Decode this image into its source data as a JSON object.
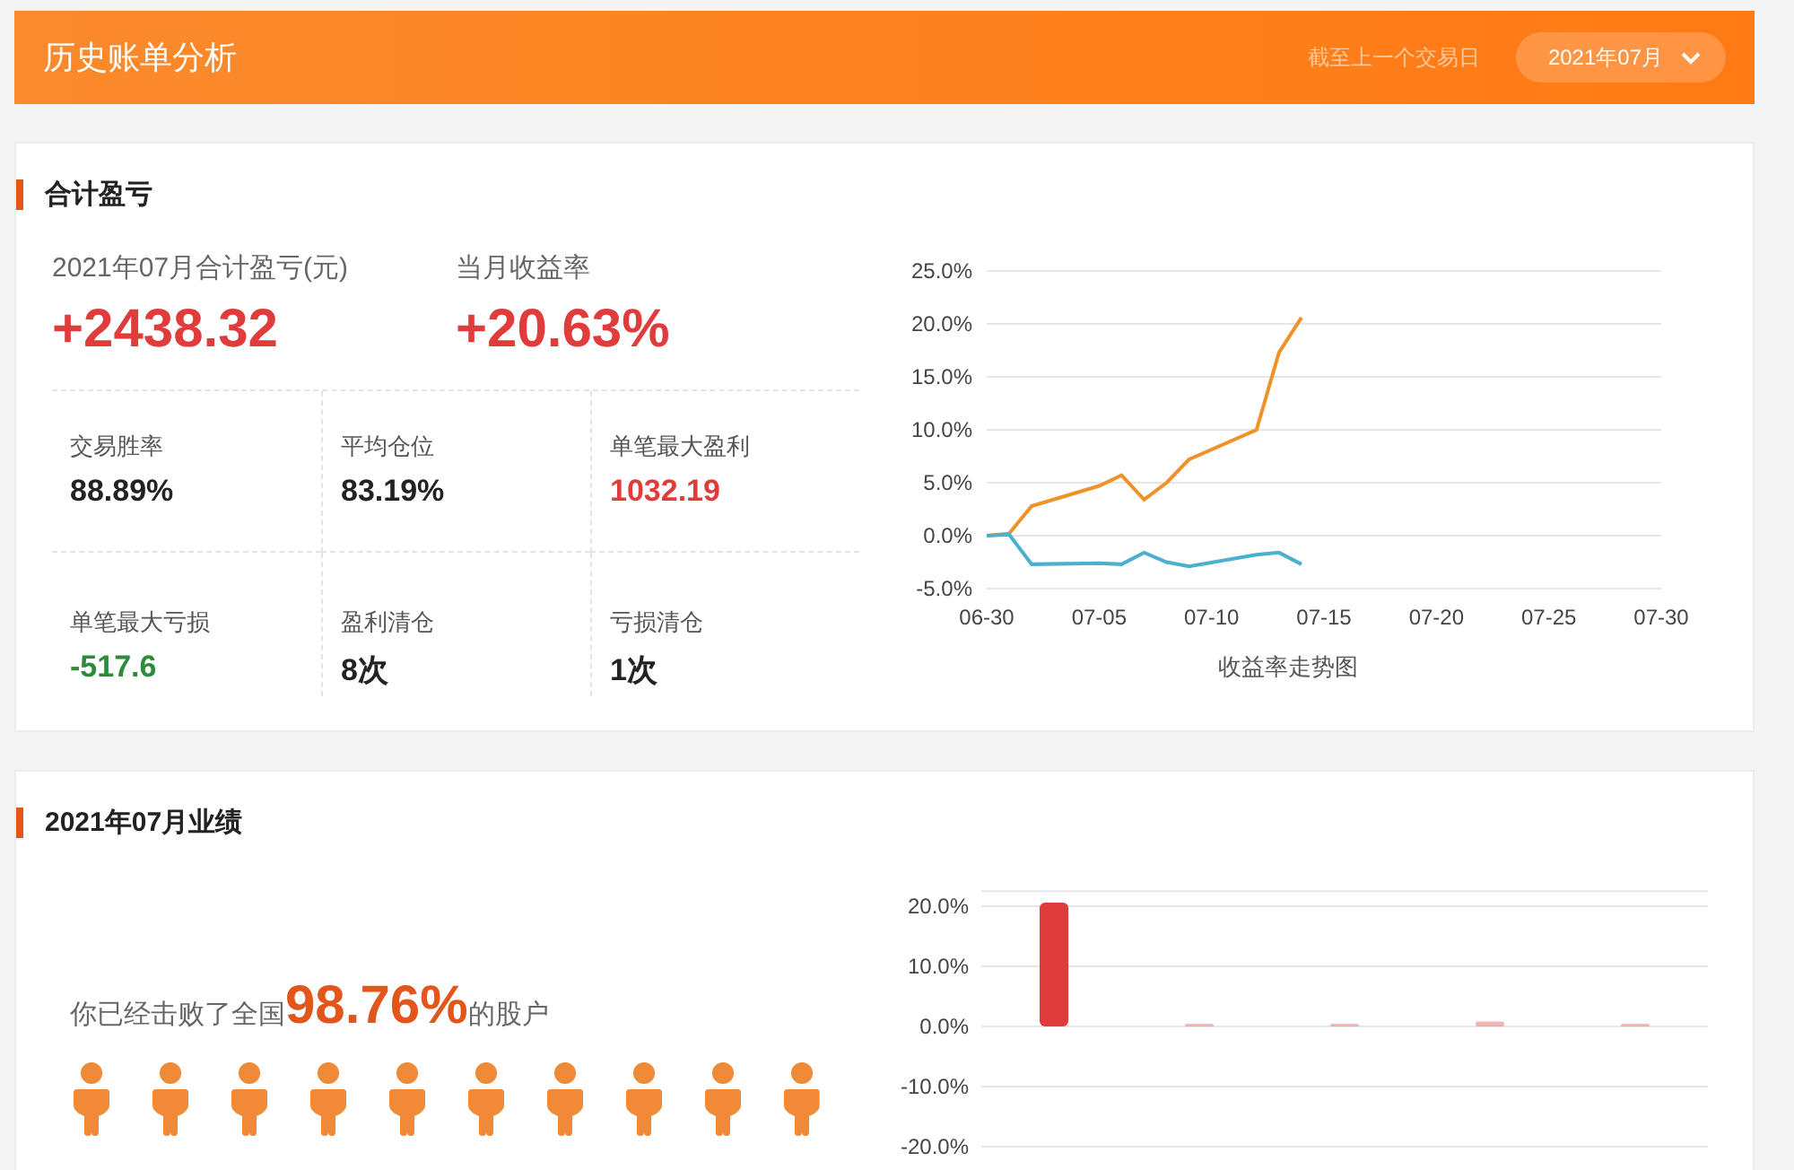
{
  "header": {
    "title": "历史账单分析",
    "note": "截至上一个交易日",
    "month_picker": {
      "value": "2021年07月"
    }
  },
  "summary": {
    "title": "合计盈亏",
    "total": {
      "label": "2021年07月合计盈亏(元)",
      "value": "+2438.32"
    },
    "rate": {
      "label": "当月收益率",
      "value": "+20.63%"
    },
    "stats": [
      {
        "label": "交易胜率",
        "value": "88.89%",
        "kind": "neutral"
      },
      {
        "label": "平均仓位",
        "value": "83.19%",
        "kind": "neutral"
      },
      {
        "label": "单笔最大盈利",
        "value": "1032.19",
        "kind": "gain"
      },
      {
        "label": "单笔最大亏损",
        "value": "-517.6",
        "kind": "loss"
      },
      {
        "label": "盈利清仓",
        "value": "8次",
        "kind": "neutral"
      },
      {
        "label": "亏损清仓",
        "value": "1次",
        "kind": "neutral"
      }
    ],
    "chart_data": {
      "type": "line",
      "title": "收益率走势图",
      "categories": [
        "06-30",
        null,
        null,
        null,
        null,
        "07-05",
        null,
        null,
        null,
        null,
        "07-10",
        null,
        null,
        null,
        null,
        "07-15",
        null,
        null,
        null,
        null,
        "07-20",
        null,
        null,
        null,
        null,
        "07-25",
        null,
        null,
        null,
        null,
        "07-30"
      ],
      "series": [
        {
          "color": "#f0922a",
          "values": [
            0,
            0.2,
            2.8,
            null,
            null,
            4.7,
            5.7,
            3.4,
            5.0,
            7.2,
            null,
            null,
            10.0,
            17.3,
            20.6,
            null,
            null,
            null,
            null,
            null,
            null,
            null,
            null,
            null,
            null,
            null,
            null,
            null,
            null,
            null,
            null
          ]
        },
        {
          "color": "#4bafd0",
          "values": [
            0,
            0.1,
            -2.7,
            null,
            null,
            -2.6,
            -2.7,
            -1.6,
            -2.5,
            -2.9,
            null,
            null,
            -1.8,
            -1.6,
            -2.7,
            null,
            null,
            null,
            null,
            null,
            null,
            null,
            null,
            null,
            null,
            null,
            null,
            null,
            null,
            null,
            null
          ]
        }
      ],
      "ylim": [
        -5,
        25
      ],
      "grid": true,
      "yticks": [
        {
          "value": -5,
          "label": "-5.0%"
        },
        {
          "value": 0,
          "label": "0.0%"
        },
        {
          "value": 5,
          "label": "5.0%"
        },
        {
          "value": 10,
          "label": "10.0%"
        },
        {
          "value": 15,
          "label": "15.0%"
        },
        {
          "value": 20,
          "label": "20.0%"
        },
        {
          "value": 25,
          "label": "25.0%"
        }
      ]
    }
  },
  "performance": {
    "title": "2021年07月业绩",
    "beat": {
      "before": "你已经击败了全国",
      "percent": "98.76%",
      "after": "的股户"
    },
    "people": {
      "level": 0.9876
    },
    "chart_data": {
      "type": "bar",
      "values": [
        20.6,
        0.3,
        0.4,
        0.8,
        0.1
      ],
      "ylim": [
        -20,
        22.5
      ],
      "grid": true,
      "yticks": [
        {
          "value": -20,
          "label": "-20.0%"
        },
        {
          "value": -10,
          "label": "-10.0%"
        },
        {
          "value": 0,
          "label": "0.0%"
        },
        {
          "value": 10,
          "label": "10.0%"
        },
        {
          "value": 20,
          "label": "20.0%"
        }
      ]
    }
  }
}
